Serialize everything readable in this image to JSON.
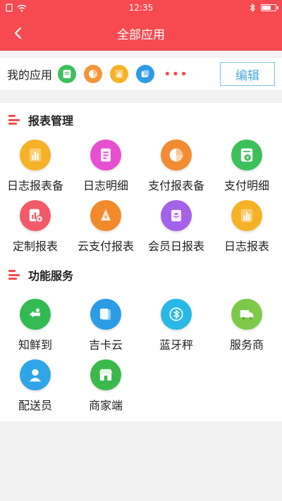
{
  "status": {
    "time": "12:35"
  },
  "nav": {
    "title": "全部应用"
  },
  "my_apps": {
    "label": "我的应用",
    "icons": [
      {
        "name": "report-icon",
        "color": "#3cc05a"
      },
      {
        "name": "pie-chart-icon",
        "color": "#f4953a"
      },
      {
        "name": "bar-chart-icon",
        "color": "#f5b324"
      },
      {
        "name": "box-icon",
        "color": "#2f9ae6"
      }
    ],
    "more": "•••",
    "edit": "编辑"
  },
  "sections": [
    {
      "title": "报表管理",
      "apps": [
        {
          "label": "日志报表备",
          "icon": "bar-chart-icon",
          "color": "#f6b227"
        },
        {
          "label": "日志明细",
          "icon": "document-icon",
          "color": "#e64fd0"
        },
        {
          "label": "支付报表备",
          "icon": "pie-chart-icon",
          "color": "#f38b33"
        },
        {
          "label": "支付明细",
          "icon": "yuan-report-icon",
          "color": "#3cc05a"
        },
        {
          "label": "定制报表",
          "icon": "custom-report-icon",
          "color": "#f25a6a"
        },
        {
          "label": "云支付报表",
          "icon": "yuan-cloud-icon",
          "color": "#f28a2c"
        },
        {
          "label": "会员日报表",
          "icon": "layers-icon",
          "color": "#a462e8"
        },
        {
          "label": "日志报表",
          "icon": "bar-chart-icon",
          "color": "#f6b227"
        }
      ]
    },
    {
      "title": "功能服务",
      "apps": [
        {
          "label": "知鲜到",
          "icon": "fresh-delivery-icon",
          "color": "#33bb52"
        },
        {
          "label": "吉卡云",
          "icon": "card-cloud-icon",
          "color": "#2c9ce5"
        },
        {
          "label": "蓝牙秤",
          "icon": "bluetooth-icon",
          "color": "#29b8e6"
        },
        {
          "label": "服务商",
          "icon": "truck-icon",
          "color": "#7ec94a"
        },
        {
          "label": "配送员",
          "icon": "courier-icon",
          "color": "#2fa5e8"
        },
        {
          "label": "商家端",
          "icon": "shop-icon",
          "color": "#3cb94c"
        }
      ]
    }
  ]
}
